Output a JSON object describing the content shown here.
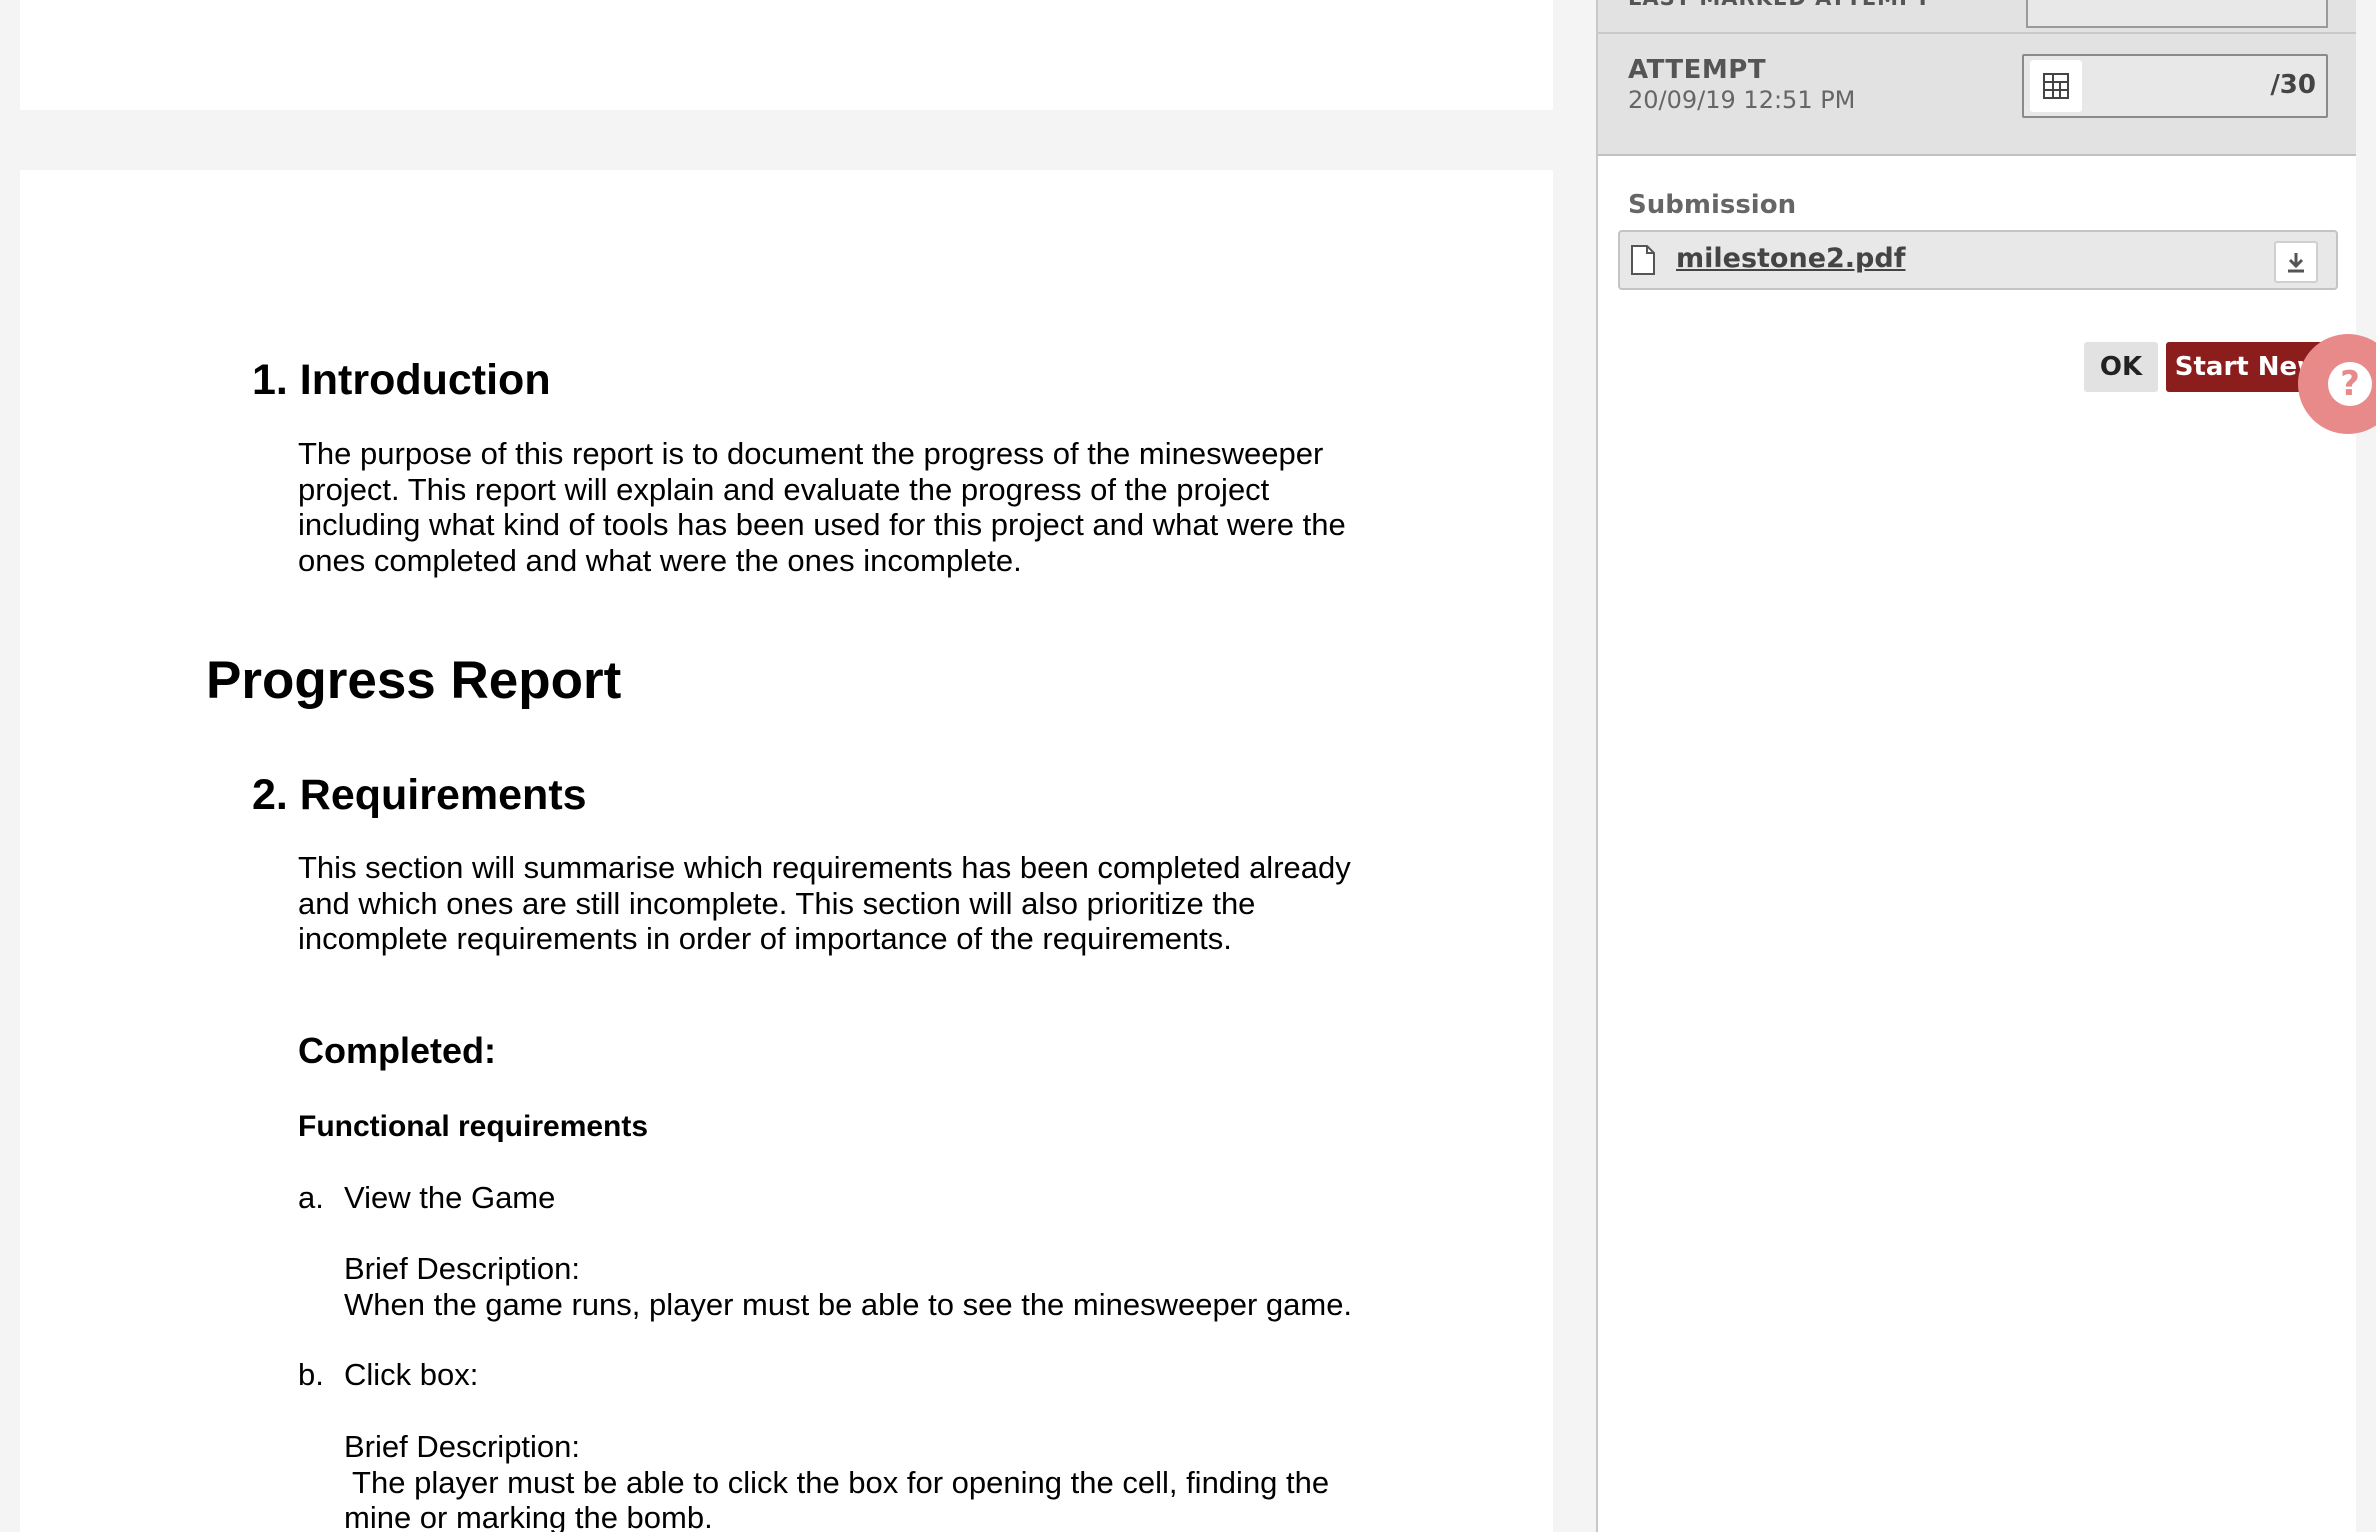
{
  "document": {
    "sections": {
      "intro_heading": "1. Introduction",
      "intro_lines": [
        "The purpose of this report is to document the progress of the minesweeper",
        "project.  This report will explain and evaluate the progress of the project",
        "including what kind of tools has been used for this project and what were the",
        "ones completed and what were the ones incomplete."
      ],
      "progress_heading": "Progress Report",
      "req_heading": "2. Requirements",
      "req_lines": [
        "This section will summarise which requirements has been completed already",
        "and which ones are still incomplete. This section will also prioritize the",
        "incomplete requirements in order of importance of the requirements."
      ],
      "completed_heading": "Completed:",
      "functional_heading": "Functional requirements",
      "item_a_marker": "a.",
      "item_a_title": "View the Game",
      "item_a_desc_label": "Brief Description:",
      "item_a_desc": "When the game runs, player must be able to see the minesweeper game.",
      "item_b_marker": "b.",
      "item_b_title": "Click box:",
      "item_b_desc_label": "Brief Description:",
      "item_b_desc_lines": [
        " The player must be able to click the box for opening the cell, finding the",
        "mine or marking the bomb."
      ]
    }
  },
  "panel": {
    "prev_attempt_label": "LAST MARKED ATTEMPT",
    "attempt_label": "ATTEMPT",
    "attempt_date": "20/09/19 12:51 PM",
    "grade_suffix": "/30",
    "grade_icon": "rubric-grid-icon",
    "submission_label": "Submission",
    "file_name": "milestone2.pdf",
    "file_icon": "document-icon",
    "download_icon": "download-icon",
    "ok_label": "OK",
    "start_new_label": "Start New",
    "help_glyph": "?",
    "colors": {
      "start_new_bg": "#8c1d1d",
      "help_tab": "#e88a8a"
    }
  }
}
